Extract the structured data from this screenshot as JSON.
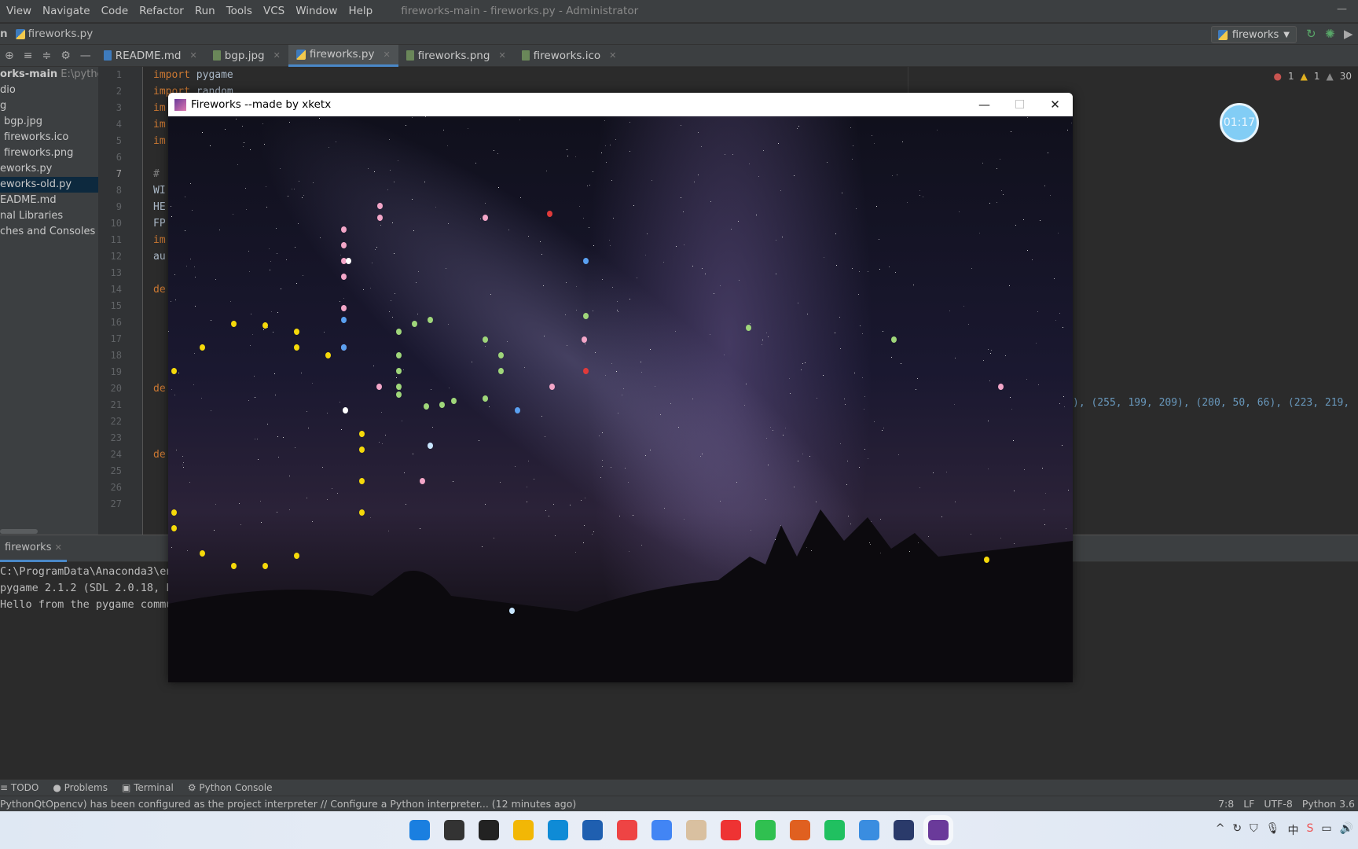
{
  "menu": {
    "items": [
      "View",
      "Navigate",
      "Code",
      "Refactor",
      "Run",
      "Tools",
      "VCS",
      "Window",
      "Help"
    ],
    "title": "fireworks-main - fireworks.py - Administrator"
  },
  "nav": {
    "crumb_root": "n",
    "crumb_file": "fireworks.py",
    "run_config": "fireworks"
  },
  "tabs": [
    {
      "label": "README.md",
      "active": false
    },
    {
      "label": "bgp.jpg",
      "active": false
    },
    {
      "label": "fireworks.py",
      "active": true
    },
    {
      "label": "fireworks.png",
      "active": false
    },
    {
      "label": "fireworks.ico",
      "active": false
    }
  ],
  "project": {
    "root": "orks-main",
    "root_path": "E:\\python",
    "items": [
      "dio",
      "g",
      "bgp.jpg",
      "fireworks.ico",
      "fireworks.png",
      "eworks.py",
      "eworks-old.py",
      "EADME.md",
      "nal Libraries",
      "ches and Consoles"
    ],
    "selected_index": 6
  },
  "editor": {
    "lines": [
      "import pygame",
      "import random",
      "im",
      "im",
      "im",
      "",
      "# ",
      "WI",
      "HE",
      "FP",
      "im",
      "au",
      "",
      "de",
      "",
      "",
      "",
      "",
      "",
      "de",
      "",
      "",
      "",
      "de",
      "",
      "",
      ""
    ],
    "right_fragment": "), (255, 199, 209), (200, 50, 66), (223, 219,",
    "current_line": 7
  },
  "inspections": {
    "errors": "1",
    "warnings": "1",
    "weak": "30"
  },
  "timer": "01:17",
  "run": {
    "tab": "fireworks",
    "console": [
      "C:\\ProgramData\\Anaconda3\\en",
      "pygame 2.1.2 (SDL 2.0.18, P",
      "Hello from the pygame commu"
    ]
  },
  "tool_windows": [
    "TODO",
    "Problems",
    "Terminal",
    "Python Console"
  ],
  "status": {
    "message": "PythonQtOpencv) has been configured as the project interpreter // Configure a Python interpreter... (12 minutes ago)",
    "position": "7:8",
    "line_sep": "LF",
    "encoding": "UTF-8",
    "interpreter": "Python 3.6"
  },
  "game": {
    "title": "Fireworks --made by xketx",
    "particle_colors": [
      "#f5d90a",
      "#f3a6c8",
      "#9fd67a",
      "#5aa0f0",
      "#e03a3a",
      "#ffffff",
      "#c8e6ff",
      "#ffb0d0"
    ]
  },
  "taskbar": {
    "apps": [
      "start",
      "search",
      "task-view",
      "file-explorer",
      "edge",
      "store",
      "app",
      "chrome",
      "app",
      "wps",
      "iqiyi",
      "matlab",
      "pycharm",
      "app",
      "app",
      "fireworks"
    ],
    "colors": [
      "#1a7fe0",
      "#333",
      "#222",
      "#f2b705",
      "#0f8bd6",
      "#1f5fb0",
      "#e44",
      "#4285f4",
      "#d9c0a0",
      "#e33",
      "#30c050",
      "#e06020",
      "#20c060",
      "#3a8de0",
      "#2a3a6a",
      "#6a3a9a"
    ]
  }
}
